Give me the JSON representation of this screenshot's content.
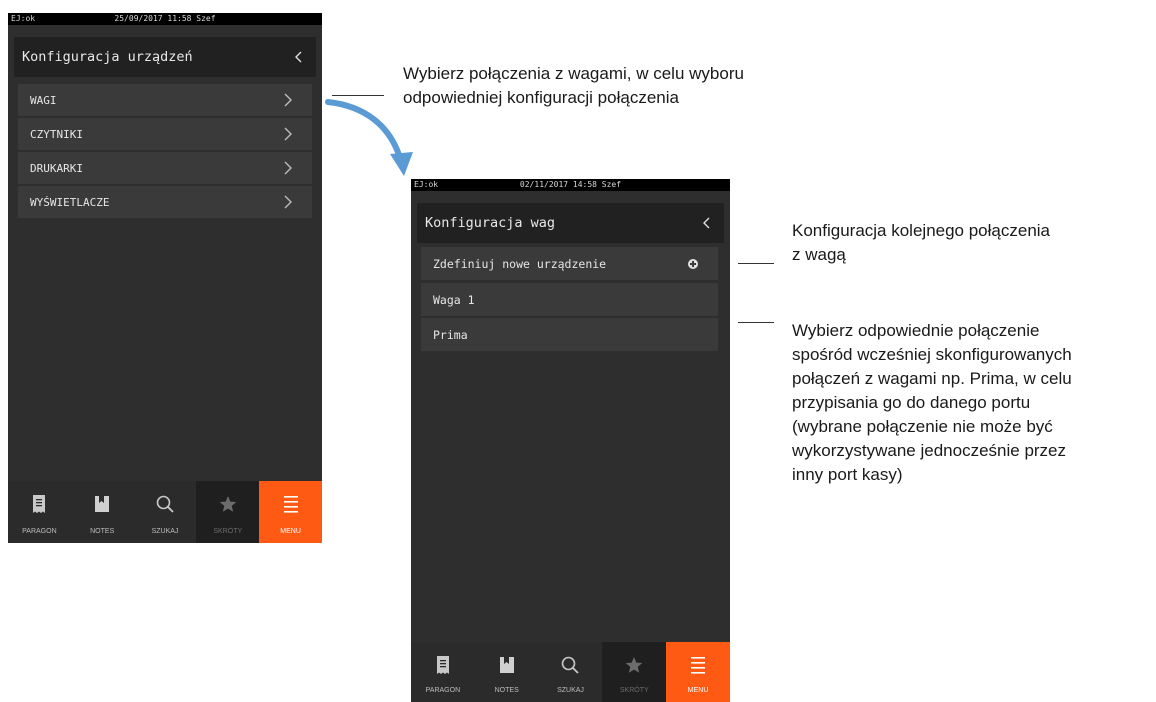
{
  "screen1": {
    "status_left": "EJ:ok",
    "status_datetime": "25/09/2017 11:58 Szef",
    "title": "Konfiguracja urządzeń",
    "items": [
      {
        "label": "WAGI"
      },
      {
        "label": "CZYTNIKI"
      },
      {
        "label": "DRUKARKI"
      },
      {
        "label": "WYŚWIETLACZE"
      }
    ]
  },
  "screen2": {
    "status_left": "EJ:ok",
    "status_datetime": "02/11/2017 14:58 Szef",
    "title": "Konfiguracja wag",
    "items": [
      {
        "label": "Zdefiniuj nowe urządzenie",
        "icon": "plus-circle-icon"
      },
      {
        "label": "Waga 1"
      },
      {
        "label": "Prima"
      }
    ]
  },
  "nav": {
    "items": [
      {
        "label": "PARAGON",
        "icon": "receipt-icon"
      },
      {
        "label": "NOTES",
        "icon": "bookmark-icon"
      },
      {
        "label": "SZUKAJ",
        "icon": "search-icon"
      },
      {
        "label": "SKRÓTY",
        "icon": "star-icon"
      },
      {
        "label": "MENU",
        "icon": "menu-icon"
      }
    ],
    "active_color": "#ff5a14"
  },
  "annotations": {
    "a1_line1": "Wybierz połączenia z wagami, w celu wyboru",
    "a1_line2": "odpowiedniej konfiguracji połączenia",
    "a2_line1": "Konfiguracja kolejnego połączenia",
    "a2_line2": "z wagą",
    "a3_lines": [
      "Wybierz odpowiednie połączenie",
      "spośród wcześniej skonfigurowanych",
      "połączeń z wagami np. Prima, w celu",
      "przypisania go do danego portu",
      "(wybrane połączenie nie może być",
      "wykorzystywane jednocześnie przez",
      "inny port kasy)"
    ],
    "arrow_color": "#5b9bd5"
  }
}
